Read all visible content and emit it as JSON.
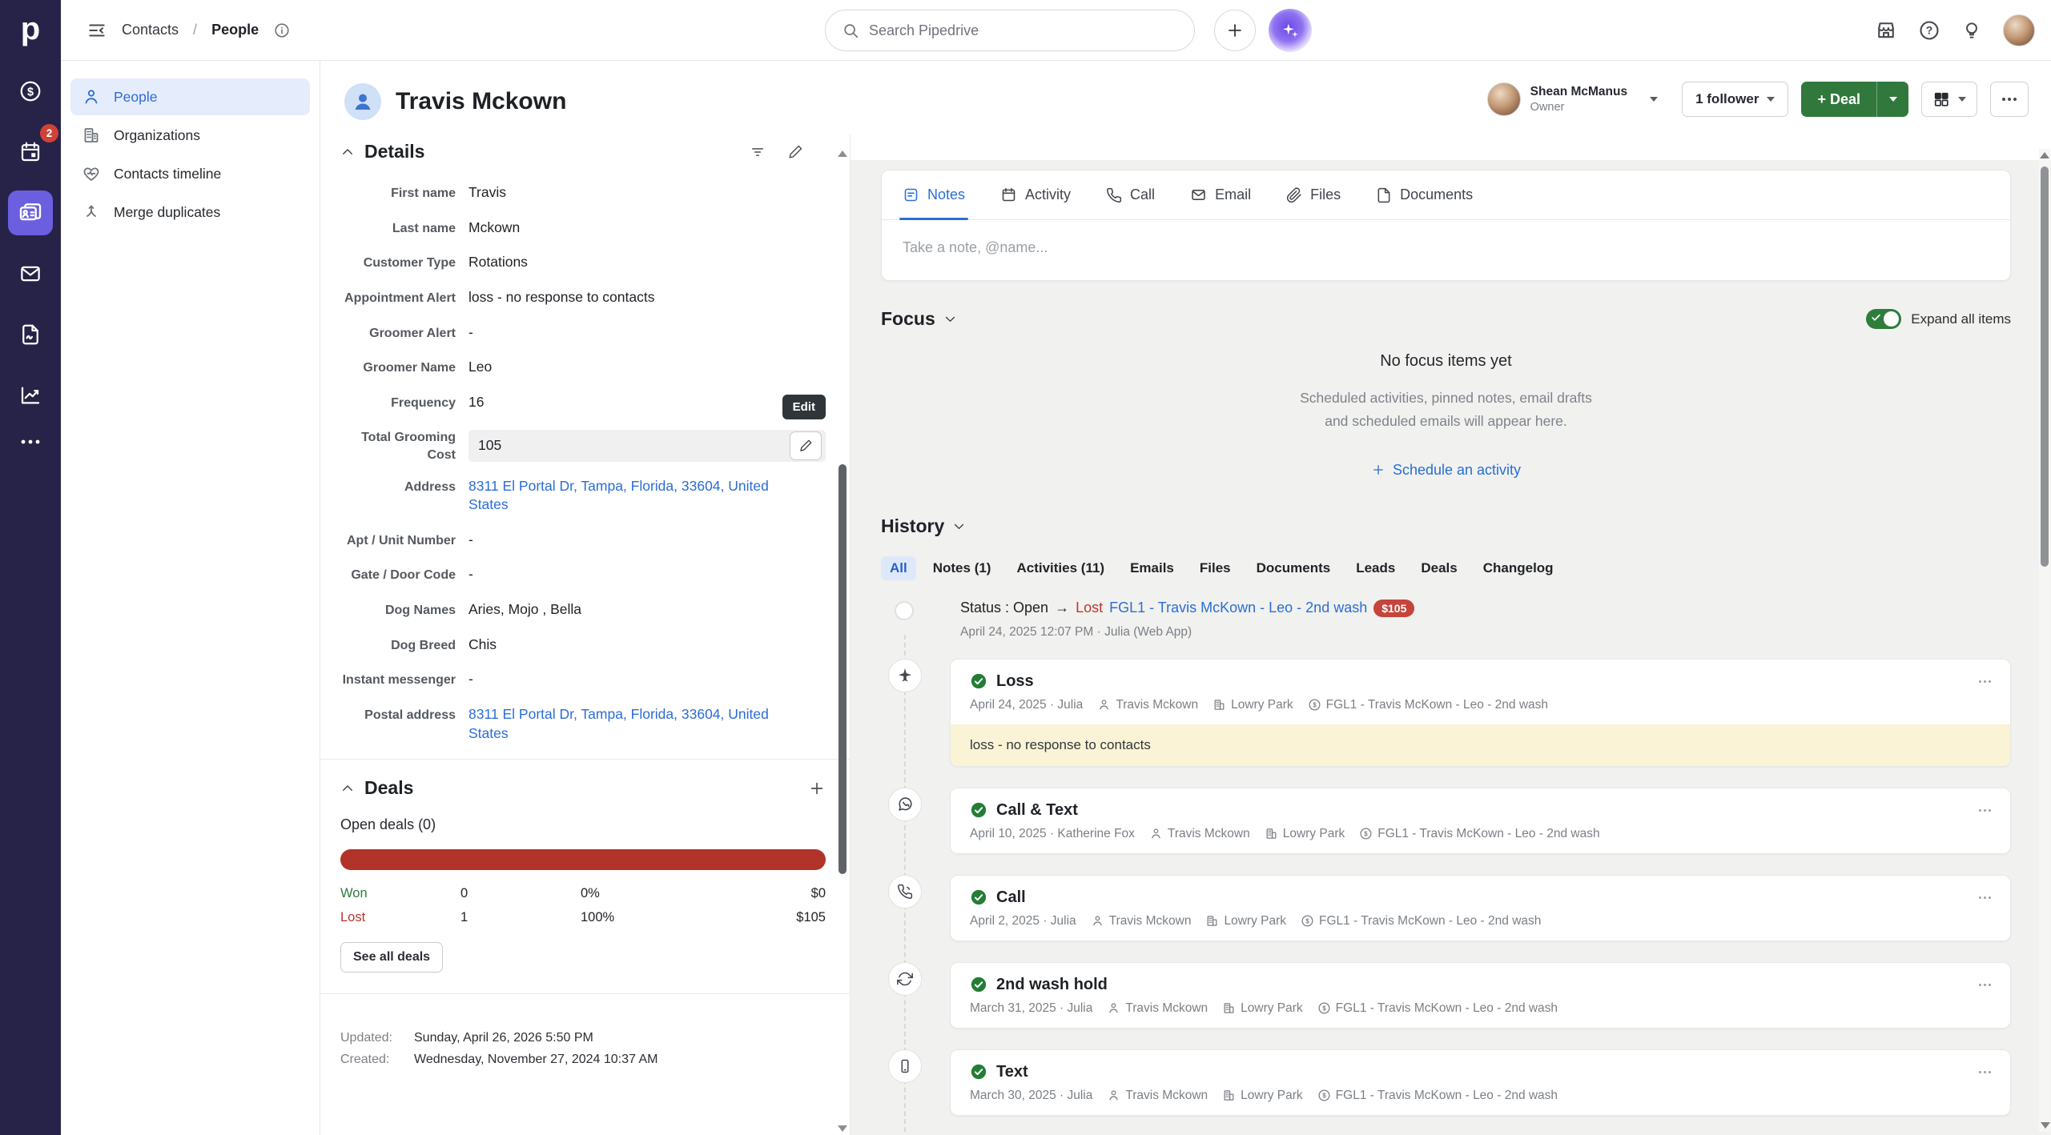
{
  "rail": {
    "logo": "p",
    "badge": "2"
  },
  "topbar": {
    "breadcrumb_section": "Contacts",
    "breadcrumb_sep": "/",
    "breadcrumb_page": "People",
    "search_placeholder": "Search Pipedrive"
  },
  "sidebar": {
    "items": [
      {
        "label": "People"
      },
      {
        "label": "Organizations"
      },
      {
        "label": "Contacts timeline"
      },
      {
        "label": "Merge duplicates"
      }
    ]
  },
  "header": {
    "title": "Travis Mckown",
    "owner_name": "Shean McManus",
    "owner_role": "Owner",
    "followers_label": "1 follower",
    "deal_label": "+ Deal"
  },
  "details": {
    "title": "Details",
    "edit_tooltip": "Edit",
    "fields": [
      {
        "label": "First name",
        "value": "Travis"
      },
      {
        "label": "Last name",
        "value": "Mckown"
      },
      {
        "label": "Customer Type",
        "value": "Rotations"
      },
      {
        "label": "Appointment Alert",
        "value": "loss - no response to contacts"
      },
      {
        "label": "Groomer Alert",
        "value": "-"
      },
      {
        "label": "Groomer Name",
        "value": "Leo"
      },
      {
        "label": "Frequency",
        "value": "16"
      },
      {
        "label": "Total Grooming Cost",
        "value": "105"
      },
      {
        "label": "Address",
        "value": "8311 El Portal Dr, Tampa, Florida, 33604, United States"
      },
      {
        "label": "Apt / Unit Number",
        "value": "-"
      },
      {
        "label": "Gate / Door Code",
        "value": "-"
      },
      {
        "label": "Dog Names",
        "value": "Aries, Mojo , Bella"
      },
      {
        "label": "Dog Breed",
        "value": "Chis"
      },
      {
        "label": "Instant messenger",
        "value": "-"
      },
      {
        "label": "Postal address",
        "value": "8311 El Portal Dr, Tampa, Florida, 33604, United States"
      }
    ]
  },
  "deals": {
    "title": "Deals",
    "open_label": "Open deals (0)",
    "rows": [
      {
        "name": "Won",
        "count": "0",
        "percent": "0%",
        "amount": "$0"
      },
      {
        "name": "Lost",
        "count": "1",
        "percent": "100%",
        "amount": "$105"
      }
    ],
    "see_all_label": "See all deals",
    "updated_label": "Updated:",
    "updated_value": "Sunday, April 26, 2026 5:50 PM",
    "created_label": "Created:",
    "created_value": "Wednesday, November 27, 2024 10:37 AM"
  },
  "tabs": {
    "items": [
      {
        "label": "Notes"
      },
      {
        "label": "Activity"
      },
      {
        "label": "Call"
      },
      {
        "label": "Email"
      },
      {
        "label": "Files"
      },
      {
        "label": "Documents"
      }
    ],
    "note_placeholder": "Take a note, @name..."
  },
  "focus": {
    "title": "Focus",
    "toggle_label": "Expand all items",
    "empty_title": "No focus items yet",
    "empty_line1": "Scheduled activities, pinned notes, email drafts",
    "empty_line2": "and scheduled emails will appear here.",
    "schedule_label": "Schedule an activity"
  },
  "history": {
    "title": "History",
    "filters": [
      {
        "label": "All"
      },
      {
        "label": "Notes (1)"
      },
      {
        "label": "Activities (11)"
      },
      {
        "label": "Emails"
      },
      {
        "label": "Files"
      },
      {
        "label": "Documents"
      },
      {
        "label": "Leads"
      },
      {
        "label": "Deals"
      },
      {
        "label": "Changelog"
      }
    ],
    "status_event": {
      "prefix": "Status : Open",
      "arrow": "→",
      "status_to": "Lost",
      "deal_link": "FGL1 - Travis McKown - Leo - 2nd wash",
      "value_badge": "$105",
      "meta": "April 24, 2025 12:07 PM · Julia (Web App)"
    },
    "linked": {
      "person": "Travis Mckown",
      "org": "Lowry Park",
      "deal": "FGL1 - Travis McKown - Leo - 2nd wash"
    },
    "items": [
      {
        "title": "Loss",
        "meta": "April 24, 2025 · Julia",
        "note": "loss - no response to contacts"
      },
      {
        "title": "Call & Text",
        "meta": "April 10, 2025 · Katherine Fox"
      },
      {
        "title": "Call",
        "meta": "April 2, 2025 · Julia"
      },
      {
        "title": "2nd wash hold",
        "meta": "March 31, 2025 · Julia"
      },
      {
        "title": "Text",
        "meta": "March 30, 2025 · Julia"
      }
    ]
  },
  "colors": {
    "accent_blue": "#2a6fd6",
    "deal_green": "#31783c",
    "toggle_green": "#2e7d3b",
    "lost_red": "#b5342b",
    "badge_red": "#c5443b",
    "rail_bg": "#272348",
    "rail_active": "#6b5fe0",
    "note_yellow": "#faf3d6"
  }
}
